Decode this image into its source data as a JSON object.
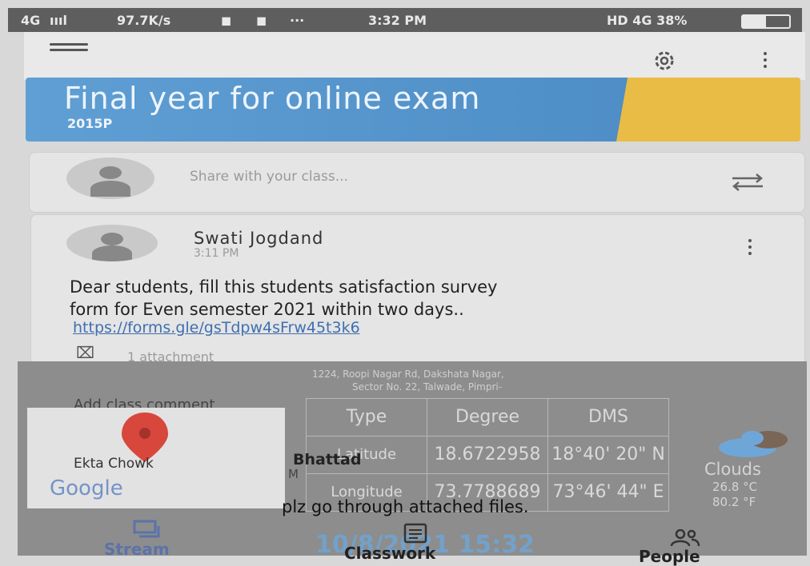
{
  "status_bar": {
    "network": "4G",
    "speed": "97.7K/s",
    "more": "···",
    "time": "3:32 PM",
    "right": "HD 4G 38%"
  },
  "class": {
    "title": "Final year for online exam",
    "section": "2015P"
  },
  "share": {
    "placeholder": "Share with your class..."
  },
  "post": {
    "author": "Swati Jogdand",
    "time": "3:11 PM",
    "body_line1": "Dear students, fill this students satisfaction survey",
    "body_line2": "form for Even semester 2021 within two days..",
    "link": "https://forms.gle/gsTdpw4sFrw45t3k6",
    "attachment": "1 attachment",
    "comment_placeholder": "Add class comment"
  },
  "overlay": {
    "address_line1": "1224, Roopi Nagar Rd, Dakshata Nagar,",
    "address_line2": "Sector No. 22, Talwade, Pimpri-",
    "map_place": "Ekta Chowk",
    "map_brand": "Google",
    "table": {
      "headers": [
        "Type",
        "Degree",
        "DMS"
      ],
      "rows": [
        [
          "Latitude",
          "18.6722958",
          "18°40' 20\" N"
        ],
        [
          "Longitude",
          "73.7788689",
          "73°46' 44\" E"
        ]
      ]
    },
    "weather": {
      "condition": "Clouds",
      "temp_c": "26.8 °C",
      "temp_f": "80.2 °F"
    },
    "timestamp": "10/8/2021 15:32"
  },
  "partial": {
    "name_fragment": "Bhattad",
    "name_fragment2": "M",
    "message": "plz go through attached files."
  },
  "bottom_nav": [
    {
      "label": "Stream"
    },
    {
      "label": "Classwork"
    },
    {
      "label": "People"
    }
  ],
  "colors": {
    "banner_blue": "#5f9fd4",
    "banner_yellow": "#e9bd45",
    "link": "#3f6fb0",
    "nav": "#5b73a9"
  }
}
